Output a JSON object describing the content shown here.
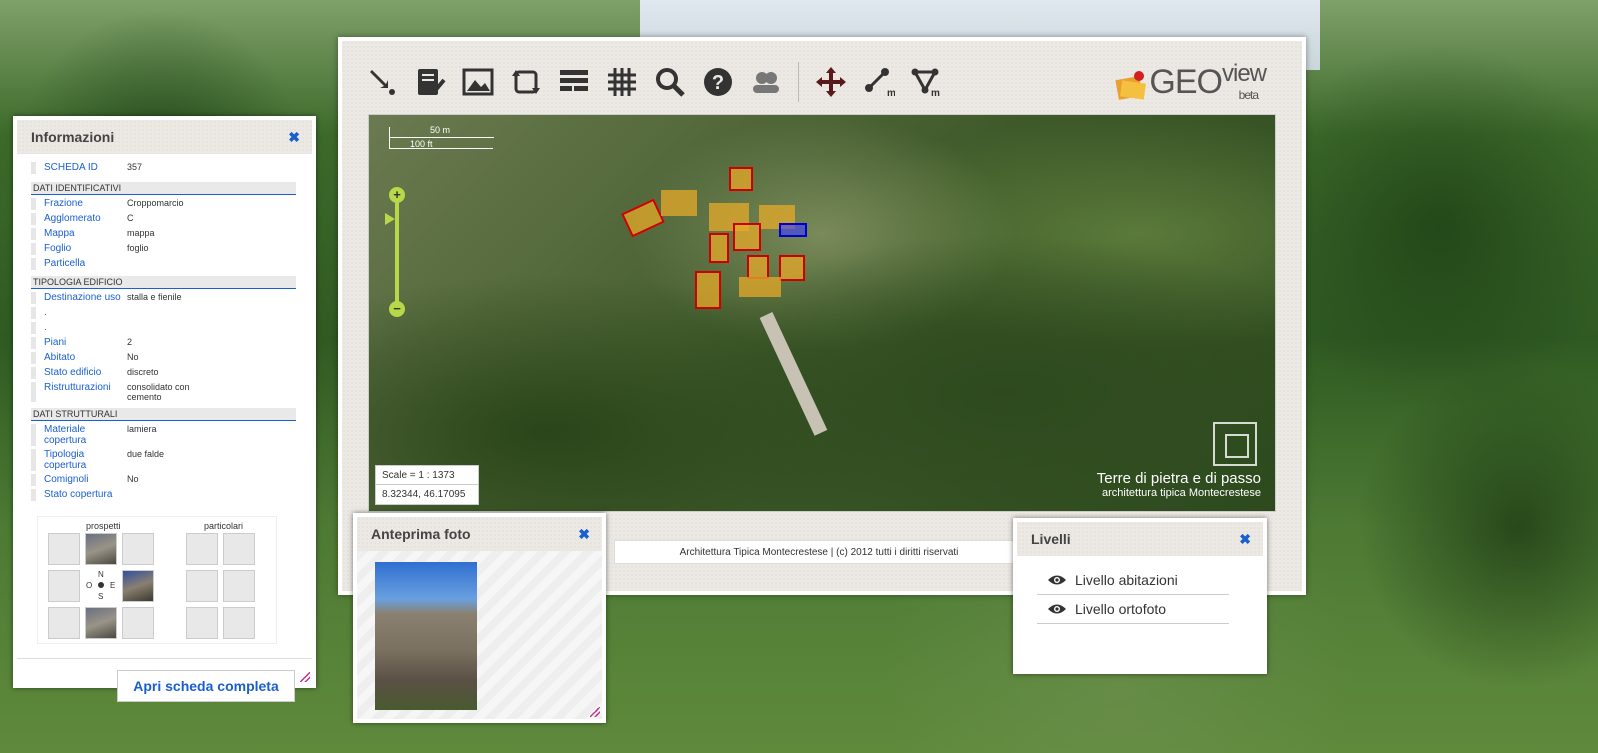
{
  "toolbar": {
    "tools": [
      "select-arrow-icon",
      "edit-list-icon",
      "image-icon",
      "extent-icon",
      "layers-list-icon",
      "grid-icon",
      "search-icon",
      "help-icon",
      "users-icon"
    ],
    "tools2": [
      "pan-icon",
      "measure-line-icon",
      "measure-area-icon"
    ]
  },
  "logo": {
    "geo": "GEO",
    "view": "view",
    "beta": "beta"
  },
  "map": {
    "scale_m": "50 m",
    "scale_ft": "100 ft",
    "scale_text": "Scale = 1 : 1373",
    "coords": "8.32344, 46.17095",
    "watermark_title": "Terre di pietra e di passo",
    "watermark_sub": "architettura tipica Montecrestese"
  },
  "footer": "Architettura Tipica Montecrestese | (c) 2012 tutti i diritti riservati",
  "info": {
    "title": "Informazioni",
    "scheda_label": "SCHEDA ID",
    "scheda_value": "357",
    "sec1": "DATI IDENTIFICATIVI",
    "frazione_k": "Frazione",
    "frazione_v": "Croppomarcio",
    "agglomerato_k": "Agglomerato",
    "agglomerato_v": "C",
    "mappa_k": "Mappa",
    "mappa_v": "mappa",
    "foglio_k": "Foglio",
    "foglio_v": "foglio",
    "particella_k": "Particella",
    "particella_v": "",
    "sec2": "TIPOLOGIA EDIFICIO",
    "dest_k": "Destinazione uso",
    "dest_v": "stalla e fienile",
    "dot1": ".",
    "dot2": ".",
    "piani_k": "Piani",
    "piani_v": "2",
    "abitato_k": "Abitato",
    "abitato_v": "No",
    "stato_k": "Stato edificio",
    "stato_v": "discreto",
    "ristr_k": "Ristrutturazioni",
    "ristr_v": "consolidato con cemento",
    "sec3": "DATI STRUTTURALI",
    "mat_k": "Materiale copertura",
    "mat_v": "lamiera",
    "tip_k": "Tipologia copertura",
    "tip_v": "due falde",
    "com_k": "Comignoli",
    "com_v": "No",
    "statocop_k": "Stato copertura",
    "statocop_v": "",
    "prospetti": "prospetti",
    "particolari": "particolari",
    "compass": {
      "n": "N",
      "o": "O",
      "e": "E",
      "s": "S"
    },
    "button": "Apri scheda completa"
  },
  "foto": {
    "title": "Anteprima foto"
  },
  "livelli": {
    "title": "Livelli",
    "items": [
      "Livello abitazioni",
      "Livello ortofoto"
    ]
  }
}
